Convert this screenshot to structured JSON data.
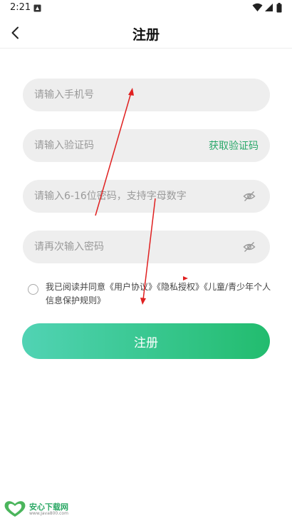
{
  "status_bar": {
    "time": "2:21"
  },
  "nav": {
    "title": "注册",
    "back_icon": "chevron-left-icon"
  },
  "form": {
    "phone_placeholder": "请输入手机号",
    "code_placeholder": "请输入验证码",
    "get_code_label": "获取验证码",
    "password_placeholder": "请输入6-16位密码，支持字母数字",
    "confirm_password_placeholder": "请再次输入密码",
    "password_toggle_icon": "eye-hidden-icon"
  },
  "agreement": {
    "checked": false,
    "prefix": "我已阅读并同意",
    "links": [
      "《用户协议》",
      "《隐私授权》",
      "《儿童/青少年个人信息保护规则》"
    ]
  },
  "register_button_label": "注册",
  "watermark": {
    "title": "安心下载网",
    "url": "www.Java800.com"
  },
  "colors": {
    "accent": "#2aa86a",
    "button_start": "#51d3b4",
    "button_end": "#22bc6e",
    "field_bg": "#eeeeee",
    "annotation": "#e02020"
  }
}
